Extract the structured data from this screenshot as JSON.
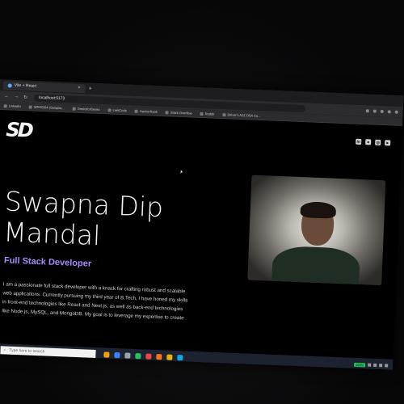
{
  "browser": {
    "tab_title": "Vite + React",
    "new_tab": "+",
    "tab_close": "×",
    "nav": {
      "back": "←",
      "forward": "→",
      "reload": "↻"
    },
    "url": "localhost:5173",
    "bookmarks": [
      "LinkedIn",
      "SDM2204 (Swapna...",
      "GeeksforGeeks",
      "LeetCode",
      "HackerRank",
      "Stack Overflow",
      "Reddit",
      "Striver's A2Z DSA Co..."
    ]
  },
  "page": {
    "logo": "SD",
    "social_icons": [
      "linkedin-icon",
      "github-icon",
      "instagram-icon",
      "twitter-icon"
    ],
    "name": "Swapna Dip Mandal",
    "role": "Full Stack Developer",
    "bio": "I am a passionate full stack developer with a knack for crafting robust and scalable web applications. Currently pursuing my third year of B.Tech, I have honed my skills in front-end technologies like React and Next.js, as well as back-end technologies like Node.js, MySQL, and MongoDB. My goal is to leverage my expertise to create",
    "role_color": "#a78bfa"
  },
  "taskbar": {
    "search_placeholder": "Type here to search",
    "tray_badge": "100%"
  }
}
